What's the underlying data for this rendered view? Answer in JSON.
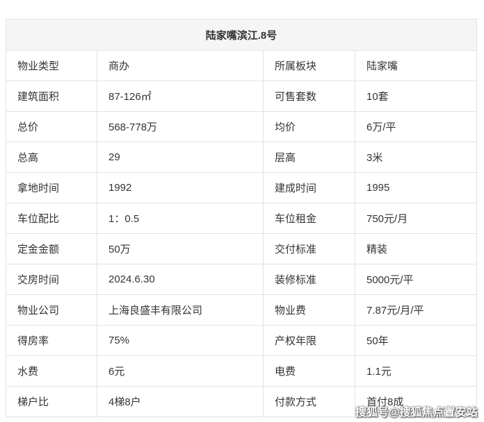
{
  "table": {
    "title": "陆家嘴滨江.8号",
    "rows": [
      [
        "物业类型",
        "商办",
        "所属板块",
        "陆家嘴"
      ],
      [
        "建筑面积",
        "87-126㎡",
        "可售套数",
        "10套"
      ],
      [
        "总价",
        "568-778万",
        "均价",
        "6万/平"
      ],
      [
        "总高",
        "29",
        "层高",
        "3米"
      ],
      [
        "拿地时间",
        "1992",
        "建成时间",
        "1995"
      ],
      [
        "车位配比",
        "1：0.5",
        "车位租金",
        "750元/月"
      ],
      [
        "定金金额",
        "50万",
        "交付标准",
        "精装"
      ],
      [
        "交房时间",
        "2024.6.30",
        "装修标准",
        "5000元/平"
      ],
      [
        "物业公司",
        "上海良盛丰有限公司",
        "物业费",
        "7.87元/月/平"
      ],
      [
        "得房率",
        "75%",
        "产权年限",
        "50年"
      ],
      [
        "水费",
        "6元",
        "电费",
        "1.1元"
      ],
      [
        "梯户比",
        "4梯8户",
        "付款方式",
        "首付8成"
      ]
    ]
  },
  "watermark": "搜狐号@搜狐焦点置安站"
}
